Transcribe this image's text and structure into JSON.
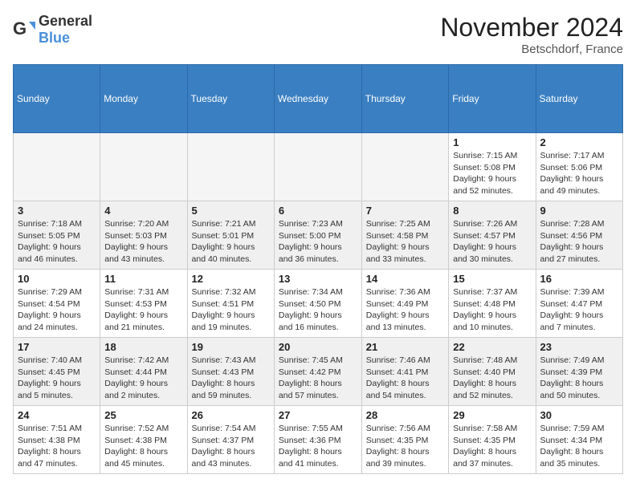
{
  "logo": {
    "general": "General",
    "blue": "Blue"
  },
  "header": {
    "month": "November 2024",
    "location": "Betschdorf, France"
  },
  "weekdays": [
    "Sunday",
    "Monday",
    "Tuesday",
    "Wednesday",
    "Thursday",
    "Friday",
    "Saturday"
  ],
  "days": [
    {
      "num": "",
      "info": ""
    },
    {
      "num": "",
      "info": ""
    },
    {
      "num": "",
      "info": ""
    },
    {
      "num": "",
      "info": ""
    },
    {
      "num": "",
      "info": ""
    },
    {
      "num": "1",
      "info": "Sunrise: 7:15 AM\nSunset: 5:08 PM\nDaylight: 9 hours\nand 52 minutes."
    },
    {
      "num": "2",
      "info": "Sunrise: 7:17 AM\nSunset: 5:06 PM\nDaylight: 9 hours\nand 49 minutes."
    },
    {
      "num": "3",
      "info": "Sunrise: 7:18 AM\nSunset: 5:05 PM\nDaylight: 9 hours\nand 46 minutes."
    },
    {
      "num": "4",
      "info": "Sunrise: 7:20 AM\nSunset: 5:03 PM\nDaylight: 9 hours\nand 43 minutes."
    },
    {
      "num": "5",
      "info": "Sunrise: 7:21 AM\nSunset: 5:01 PM\nDaylight: 9 hours\nand 40 minutes."
    },
    {
      "num": "6",
      "info": "Sunrise: 7:23 AM\nSunset: 5:00 PM\nDaylight: 9 hours\nand 36 minutes."
    },
    {
      "num": "7",
      "info": "Sunrise: 7:25 AM\nSunset: 4:58 PM\nDaylight: 9 hours\nand 33 minutes."
    },
    {
      "num": "8",
      "info": "Sunrise: 7:26 AM\nSunset: 4:57 PM\nDaylight: 9 hours\nand 30 minutes."
    },
    {
      "num": "9",
      "info": "Sunrise: 7:28 AM\nSunset: 4:56 PM\nDaylight: 9 hours\nand 27 minutes."
    },
    {
      "num": "10",
      "info": "Sunrise: 7:29 AM\nSunset: 4:54 PM\nDaylight: 9 hours\nand 24 minutes."
    },
    {
      "num": "11",
      "info": "Sunrise: 7:31 AM\nSunset: 4:53 PM\nDaylight: 9 hours\nand 21 minutes."
    },
    {
      "num": "12",
      "info": "Sunrise: 7:32 AM\nSunset: 4:51 PM\nDaylight: 9 hours\nand 19 minutes."
    },
    {
      "num": "13",
      "info": "Sunrise: 7:34 AM\nSunset: 4:50 PM\nDaylight: 9 hours\nand 16 minutes."
    },
    {
      "num": "14",
      "info": "Sunrise: 7:36 AM\nSunset: 4:49 PM\nDaylight: 9 hours\nand 13 minutes."
    },
    {
      "num": "15",
      "info": "Sunrise: 7:37 AM\nSunset: 4:48 PM\nDaylight: 9 hours\nand 10 minutes."
    },
    {
      "num": "16",
      "info": "Sunrise: 7:39 AM\nSunset: 4:47 PM\nDaylight: 9 hours\nand 7 minutes."
    },
    {
      "num": "17",
      "info": "Sunrise: 7:40 AM\nSunset: 4:45 PM\nDaylight: 9 hours\nand 5 minutes."
    },
    {
      "num": "18",
      "info": "Sunrise: 7:42 AM\nSunset: 4:44 PM\nDaylight: 9 hours\nand 2 minutes."
    },
    {
      "num": "19",
      "info": "Sunrise: 7:43 AM\nSunset: 4:43 PM\nDaylight: 8 hours\nand 59 minutes."
    },
    {
      "num": "20",
      "info": "Sunrise: 7:45 AM\nSunset: 4:42 PM\nDaylight: 8 hours\nand 57 minutes."
    },
    {
      "num": "21",
      "info": "Sunrise: 7:46 AM\nSunset: 4:41 PM\nDaylight: 8 hours\nand 54 minutes."
    },
    {
      "num": "22",
      "info": "Sunrise: 7:48 AM\nSunset: 4:40 PM\nDaylight: 8 hours\nand 52 minutes."
    },
    {
      "num": "23",
      "info": "Sunrise: 7:49 AM\nSunset: 4:39 PM\nDaylight: 8 hours\nand 50 minutes."
    },
    {
      "num": "24",
      "info": "Sunrise: 7:51 AM\nSunset: 4:38 PM\nDaylight: 8 hours\nand 47 minutes."
    },
    {
      "num": "25",
      "info": "Sunrise: 7:52 AM\nSunset: 4:38 PM\nDaylight: 8 hours\nand 45 minutes."
    },
    {
      "num": "26",
      "info": "Sunrise: 7:54 AM\nSunset: 4:37 PM\nDaylight: 8 hours\nand 43 minutes."
    },
    {
      "num": "27",
      "info": "Sunrise: 7:55 AM\nSunset: 4:36 PM\nDaylight: 8 hours\nand 41 minutes."
    },
    {
      "num": "28",
      "info": "Sunrise: 7:56 AM\nSunset: 4:35 PM\nDaylight: 8 hours\nand 39 minutes."
    },
    {
      "num": "29",
      "info": "Sunrise: 7:58 AM\nSunset: 4:35 PM\nDaylight: 8 hours\nand 37 minutes."
    },
    {
      "num": "30",
      "info": "Sunrise: 7:59 AM\nSunset: 4:34 PM\nDaylight: 8 hours\nand 35 minutes."
    }
  ]
}
